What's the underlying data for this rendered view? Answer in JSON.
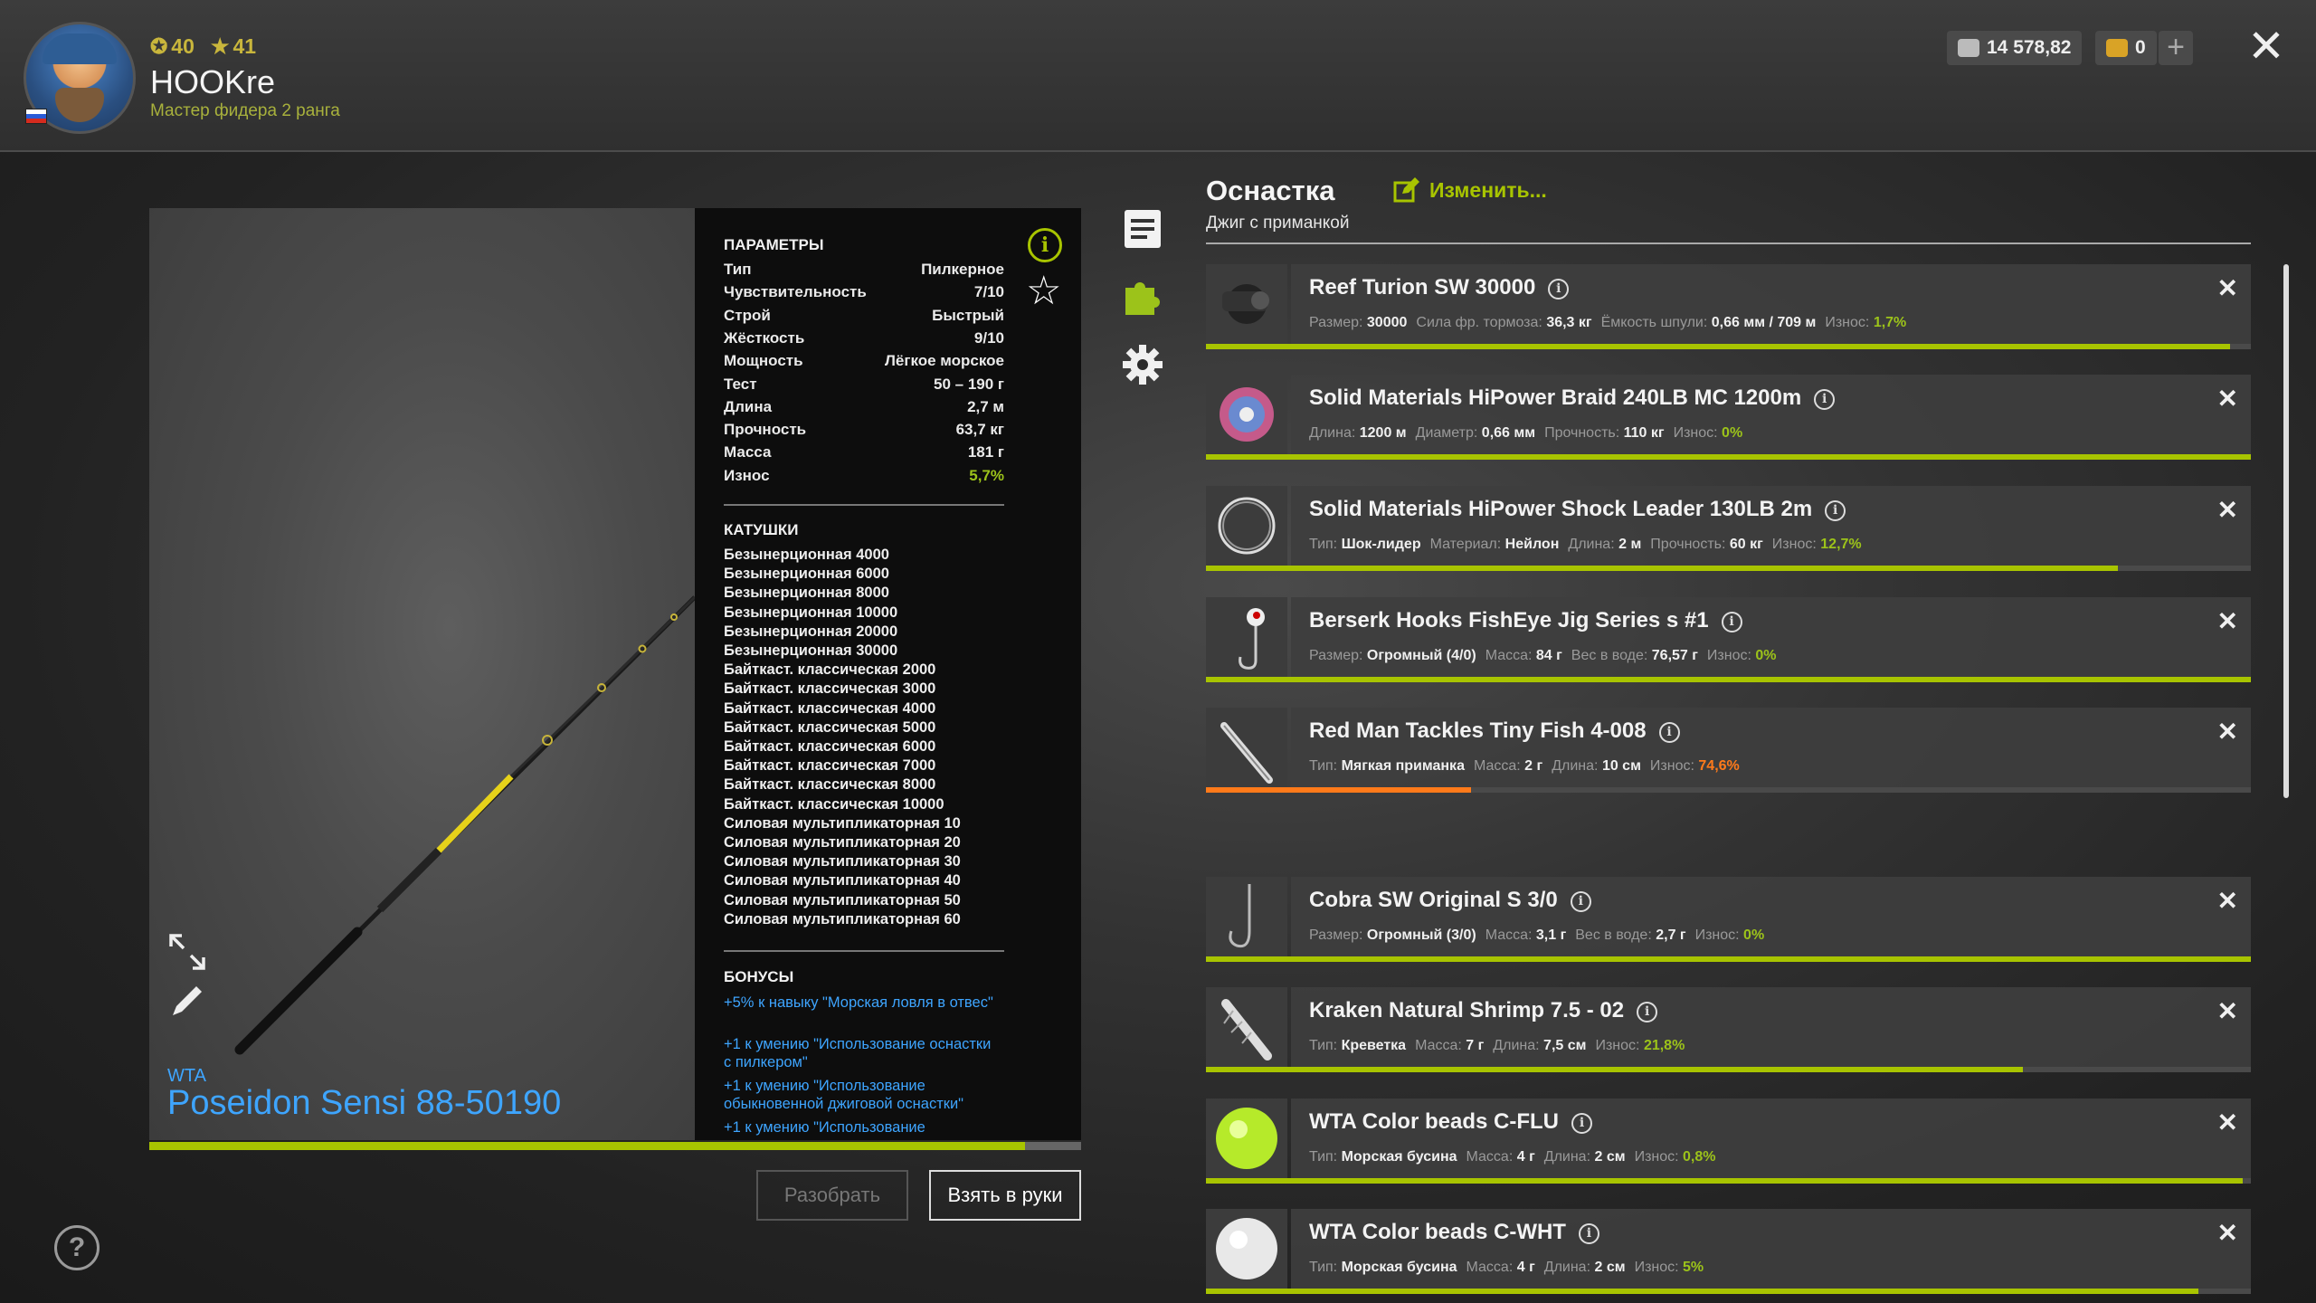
{
  "player": {
    "level": "40",
    "stars": "41",
    "nickname": "HOOKre",
    "rank": "Мастер фидера 2 ранга"
  },
  "currency": {
    "silver": "14 578,82",
    "gold": "0"
  },
  "rod": {
    "brand": "WTA",
    "name": "Poseidon Sensi 88-50190",
    "wear_fraction": 0.94
  },
  "params": {
    "title": "ПАРАМЕТРЫ",
    "rows": [
      {
        "k": "Тип",
        "v": "Пилкерное"
      },
      {
        "k": "Чувствительность",
        "v": "7/10"
      },
      {
        "k": "Строй",
        "v": "Быстрый"
      },
      {
        "k": "Жёсткость",
        "v": "9/10"
      },
      {
        "k": "Мощность",
        "v": "Лёгкое морское"
      },
      {
        "k": "Тест",
        "v": "50 – 190 г"
      },
      {
        "k": "Длина",
        "v": "2,7 м"
      },
      {
        "k": "Прочность",
        "v": "63,7 кг"
      },
      {
        "k": "Масса",
        "v": "181 г"
      },
      {
        "k": "Износ",
        "v": "5,7%"
      }
    ],
    "reels_title": "КАТУШКИ",
    "reels": [
      "Безынерционная 4000",
      "Безынерционная 6000",
      "Безынерционная 8000",
      "Безынерционная 10000",
      "Безынерционная 20000",
      "Безынерционная 30000",
      "Байткаст. классическая 2000",
      "Байткаст. классическая 3000",
      "Байткаст. классическая 4000",
      "Байткаст. классическая 5000",
      "Байткаст. классическая 6000",
      "Байткаст. классическая 7000",
      "Байткаст. классическая 8000",
      "Байткаст. классическая 10000",
      "Силовая мультипликаторная 10",
      "Силовая мультипликаторная 20",
      "Силовая мультипликаторная 30",
      "Силовая мультипликаторная 40",
      "Силовая мультипликаторная 50",
      "Силовая мультипликаторная 60"
    ],
    "bonuses_title": "БОНУСЫ",
    "bonuses": [
      "+5% к навыку \"Морская ловля в отвес\"",
      "+1 к умению \"Использование оснастки с пилкером\"",
      "+1 к умению \"Использование обыкновенной джиговой оснастки\"",
      "+1 к умению \"Использование"
    ]
  },
  "buttons": {
    "disassemble": "Разобрать",
    "take": "Взять в руки"
  },
  "tackle": {
    "title": "Оснастка",
    "edit": "Изменить...",
    "subtitle": "Джиг с приманкой",
    "items": [
      {
        "name": "Reef Turion SW 30000",
        "specs": [
          [
            "Размер:",
            "30000"
          ],
          [
            "Сила фр. тормоза:",
            "36,3 кг"
          ],
          [
            "Ёмкость шпули:",
            "0,66 мм / 709 м"
          ],
          [
            "Износ:",
            "1,7%"
          ]
        ],
        "wear_color": "green",
        "condition": 0.98
      },
      {
        "name": "Solid Materials HiPower Braid 240LB MC 1200m",
        "specs": [
          [
            "Длина:",
            "1200 м"
          ],
          [
            "Диаметр:",
            "0,66 мм"
          ],
          [
            "Прочность:",
            "110 кг"
          ],
          [
            "Износ:",
            "0%"
          ]
        ],
        "wear_color": "green",
        "condition": 1.0
      },
      {
        "name": "Solid Materials HiPower Shock Leader 130LB 2m",
        "specs": [
          [
            "Тип:",
            "Шок-лидер"
          ],
          [
            "Материал:",
            "Нейлон"
          ],
          [
            "Длина:",
            "2 м"
          ],
          [
            "Прочность:",
            "60 кг"
          ],
          [
            "Износ:",
            "12,7%"
          ]
        ],
        "wear_color": "green",
        "condition": 0.873
      },
      {
        "name": "Berserk Hooks FishEye Jig Series s #1",
        "specs": [
          [
            "Размер:",
            "Огромный (4/0)"
          ],
          [
            "Масса:",
            "84 г"
          ],
          [
            "Вес в воде:",
            "76,57 г"
          ],
          [
            "Износ:",
            "0%"
          ]
        ],
        "wear_color": "green",
        "condition": 1.0
      },
      {
        "name": "Red Man Tackles Tiny Fish 4-008",
        "specs": [
          [
            "Тип:",
            "Мягкая приманка"
          ],
          [
            "Масса:",
            "2 г"
          ],
          [
            "Длина:",
            "10 см"
          ],
          [
            "Износ:",
            "74,6%"
          ]
        ],
        "wear_color": "orange",
        "condition": 0.254
      },
      {
        "name": "Cobra SW Original S 3/0",
        "specs": [
          [
            "Размер:",
            "Огромный (3/0)"
          ],
          [
            "Масса:",
            "3,1 г"
          ],
          [
            "Вес в воде:",
            "2,7 г"
          ],
          [
            "Износ:",
            "0%"
          ]
        ],
        "wear_color": "green",
        "condition": 1.0
      },
      {
        "name": "Kraken Natural Shrimp 7.5 - 02",
        "specs": [
          [
            "Тип:",
            "Креветка"
          ],
          [
            "Масса:",
            "7 г"
          ],
          [
            "Длина:",
            "7,5 см"
          ],
          [
            "Износ:",
            "21,8%"
          ]
        ],
        "wear_color": "green",
        "condition": 0.782
      },
      {
        "name": "WTA Color beads C-FLU",
        "specs": [
          [
            "Тип:",
            "Морская бусина"
          ],
          [
            "Масса:",
            "4 г"
          ],
          [
            "Длина:",
            "2 см"
          ],
          [
            "Износ:",
            "0,8%"
          ]
        ],
        "wear_color": "green",
        "condition": 0.992
      },
      {
        "name": "WTA Color beads C-WHT",
        "specs": [
          [
            "Тип:",
            "Морская бусина"
          ],
          [
            "Масса:",
            "4 г"
          ],
          [
            "Длина:",
            "2 см"
          ],
          [
            "Износ:",
            "5%"
          ]
        ],
        "wear_color": "green",
        "condition": 0.95
      }
    ]
  },
  "colors": {
    "accent_green": "#a8c400",
    "wear_orange": "#ff7a1a",
    "link_blue": "#3ea5ff"
  }
}
